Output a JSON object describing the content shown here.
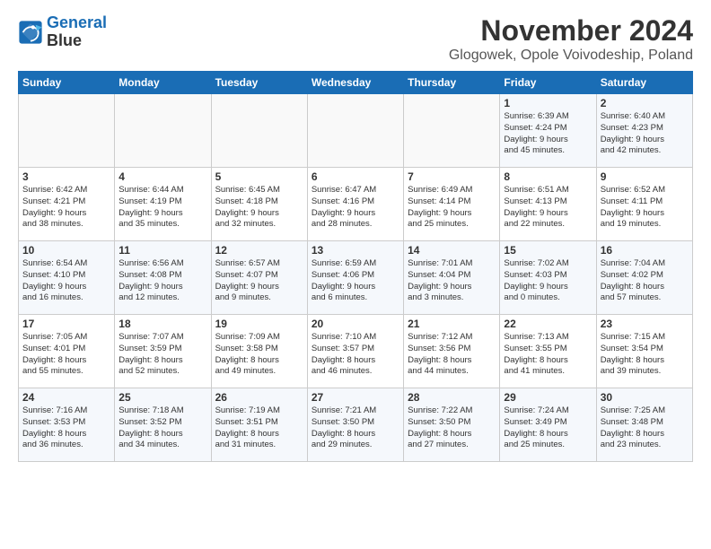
{
  "header": {
    "logo_line1": "General",
    "logo_line2": "Blue",
    "month": "November 2024",
    "location": "Glogowek, Opole Voivodeship, Poland"
  },
  "weekdays": [
    "Sunday",
    "Monday",
    "Tuesday",
    "Wednesday",
    "Thursday",
    "Friday",
    "Saturday"
  ],
  "weeks": [
    [
      {
        "day": "",
        "info": ""
      },
      {
        "day": "",
        "info": ""
      },
      {
        "day": "",
        "info": ""
      },
      {
        "day": "",
        "info": ""
      },
      {
        "day": "",
        "info": ""
      },
      {
        "day": "1",
        "info": "Sunrise: 6:39 AM\nSunset: 4:24 PM\nDaylight: 9 hours\nand 45 minutes."
      },
      {
        "day": "2",
        "info": "Sunrise: 6:40 AM\nSunset: 4:23 PM\nDaylight: 9 hours\nand 42 minutes."
      }
    ],
    [
      {
        "day": "3",
        "info": "Sunrise: 6:42 AM\nSunset: 4:21 PM\nDaylight: 9 hours\nand 38 minutes."
      },
      {
        "day": "4",
        "info": "Sunrise: 6:44 AM\nSunset: 4:19 PM\nDaylight: 9 hours\nand 35 minutes."
      },
      {
        "day": "5",
        "info": "Sunrise: 6:45 AM\nSunset: 4:18 PM\nDaylight: 9 hours\nand 32 minutes."
      },
      {
        "day": "6",
        "info": "Sunrise: 6:47 AM\nSunset: 4:16 PM\nDaylight: 9 hours\nand 28 minutes."
      },
      {
        "day": "7",
        "info": "Sunrise: 6:49 AM\nSunset: 4:14 PM\nDaylight: 9 hours\nand 25 minutes."
      },
      {
        "day": "8",
        "info": "Sunrise: 6:51 AM\nSunset: 4:13 PM\nDaylight: 9 hours\nand 22 minutes."
      },
      {
        "day": "9",
        "info": "Sunrise: 6:52 AM\nSunset: 4:11 PM\nDaylight: 9 hours\nand 19 minutes."
      }
    ],
    [
      {
        "day": "10",
        "info": "Sunrise: 6:54 AM\nSunset: 4:10 PM\nDaylight: 9 hours\nand 16 minutes."
      },
      {
        "day": "11",
        "info": "Sunrise: 6:56 AM\nSunset: 4:08 PM\nDaylight: 9 hours\nand 12 minutes."
      },
      {
        "day": "12",
        "info": "Sunrise: 6:57 AM\nSunset: 4:07 PM\nDaylight: 9 hours\nand 9 minutes."
      },
      {
        "day": "13",
        "info": "Sunrise: 6:59 AM\nSunset: 4:06 PM\nDaylight: 9 hours\nand 6 minutes."
      },
      {
        "day": "14",
        "info": "Sunrise: 7:01 AM\nSunset: 4:04 PM\nDaylight: 9 hours\nand 3 minutes."
      },
      {
        "day": "15",
        "info": "Sunrise: 7:02 AM\nSunset: 4:03 PM\nDaylight: 9 hours\nand 0 minutes."
      },
      {
        "day": "16",
        "info": "Sunrise: 7:04 AM\nSunset: 4:02 PM\nDaylight: 8 hours\nand 57 minutes."
      }
    ],
    [
      {
        "day": "17",
        "info": "Sunrise: 7:05 AM\nSunset: 4:01 PM\nDaylight: 8 hours\nand 55 minutes."
      },
      {
        "day": "18",
        "info": "Sunrise: 7:07 AM\nSunset: 3:59 PM\nDaylight: 8 hours\nand 52 minutes."
      },
      {
        "day": "19",
        "info": "Sunrise: 7:09 AM\nSunset: 3:58 PM\nDaylight: 8 hours\nand 49 minutes."
      },
      {
        "day": "20",
        "info": "Sunrise: 7:10 AM\nSunset: 3:57 PM\nDaylight: 8 hours\nand 46 minutes."
      },
      {
        "day": "21",
        "info": "Sunrise: 7:12 AM\nSunset: 3:56 PM\nDaylight: 8 hours\nand 44 minutes."
      },
      {
        "day": "22",
        "info": "Sunrise: 7:13 AM\nSunset: 3:55 PM\nDaylight: 8 hours\nand 41 minutes."
      },
      {
        "day": "23",
        "info": "Sunrise: 7:15 AM\nSunset: 3:54 PM\nDaylight: 8 hours\nand 39 minutes."
      }
    ],
    [
      {
        "day": "24",
        "info": "Sunrise: 7:16 AM\nSunset: 3:53 PM\nDaylight: 8 hours\nand 36 minutes."
      },
      {
        "day": "25",
        "info": "Sunrise: 7:18 AM\nSunset: 3:52 PM\nDaylight: 8 hours\nand 34 minutes."
      },
      {
        "day": "26",
        "info": "Sunrise: 7:19 AM\nSunset: 3:51 PM\nDaylight: 8 hours\nand 31 minutes."
      },
      {
        "day": "27",
        "info": "Sunrise: 7:21 AM\nSunset: 3:50 PM\nDaylight: 8 hours\nand 29 minutes."
      },
      {
        "day": "28",
        "info": "Sunrise: 7:22 AM\nSunset: 3:50 PM\nDaylight: 8 hours\nand 27 minutes."
      },
      {
        "day": "29",
        "info": "Sunrise: 7:24 AM\nSunset: 3:49 PM\nDaylight: 8 hours\nand 25 minutes."
      },
      {
        "day": "30",
        "info": "Sunrise: 7:25 AM\nSunset: 3:48 PM\nDaylight: 8 hours\nand 23 minutes."
      }
    ]
  ]
}
